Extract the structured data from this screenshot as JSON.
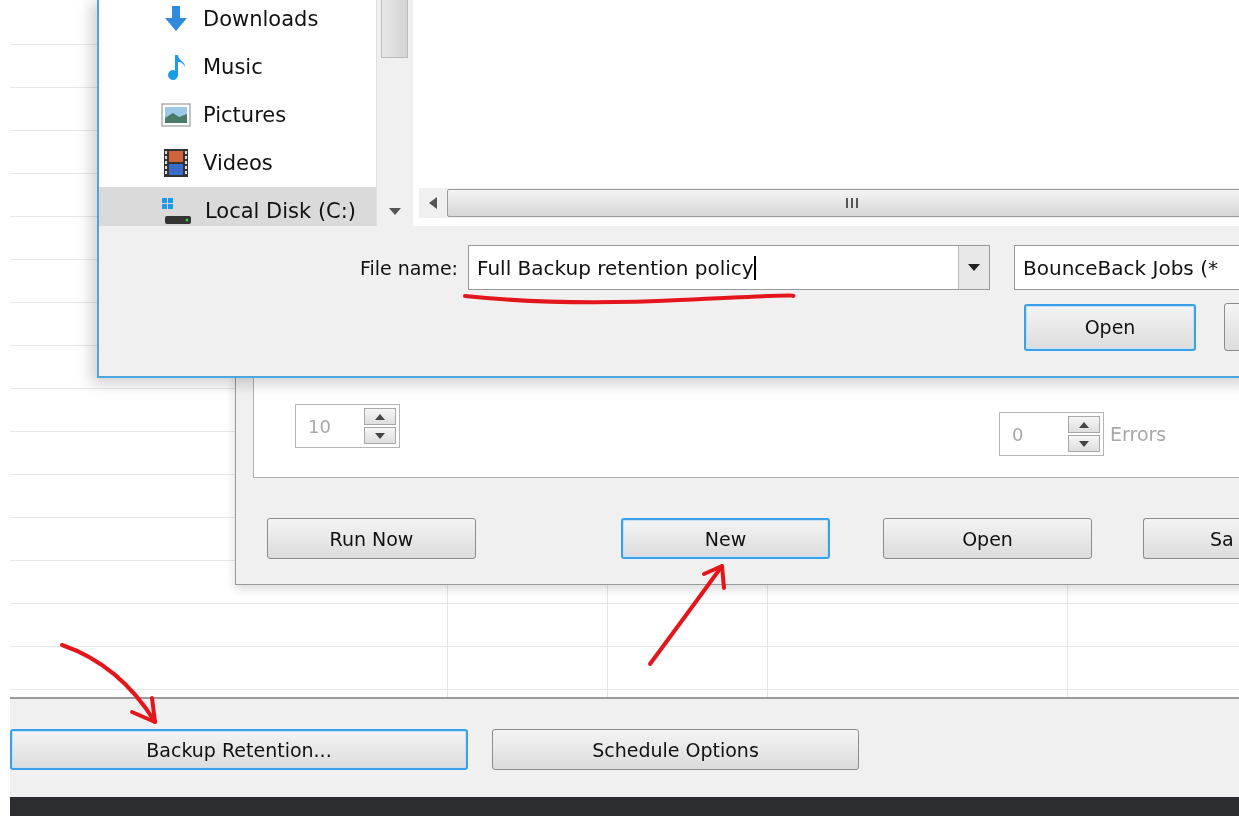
{
  "file_dialog": {
    "nav_items": [
      {
        "label": "Downloads",
        "selected": false
      },
      {
        "label": "Music",
        "selected": false
      },
      {
        "label": "Pictures",
        "selected": false
      },
      {
        "label": "Videos",
        "selected": false
      },
      {
        "label": "Local Disk (C:)",
        "selected": true
      }
    ],
    "file_name_label": "File name:",
    "file_name_value": "Full Backup retention policy",
    "file_type": "BounceBack Jobs (*",
    "open_button": "Open"
  },
  "job_window": {
    "spinners": [
      {
        "value": "10",
        "disabled": true
      },
      {
        "value": "0",
        "label": "Errors",
        "disabled": true
      }
    ],
    "buttons": [
      {
        "label": "Run Now",
        "focused": false
      },
      {
        "label": "New",
        "focused": true
      },
      {
        "label": "Open",
        "focused": false
      },
      {
        "label": "Sa",
        "focused": false
      }
    ]
  },
  "bottom_bar": {
    "buttons": [
      {
        "label": "Backup Retention...",
        "focused": true
      },
      {
        "label": "Schedule Options",
        "focused": false
      }
    ]
  },
  "annotations": [
    {
      "kind": "underline"
    },
    {
      "kind": "arrow"
    },
    {
      "kind": "arrow"
    }
  ]
}
